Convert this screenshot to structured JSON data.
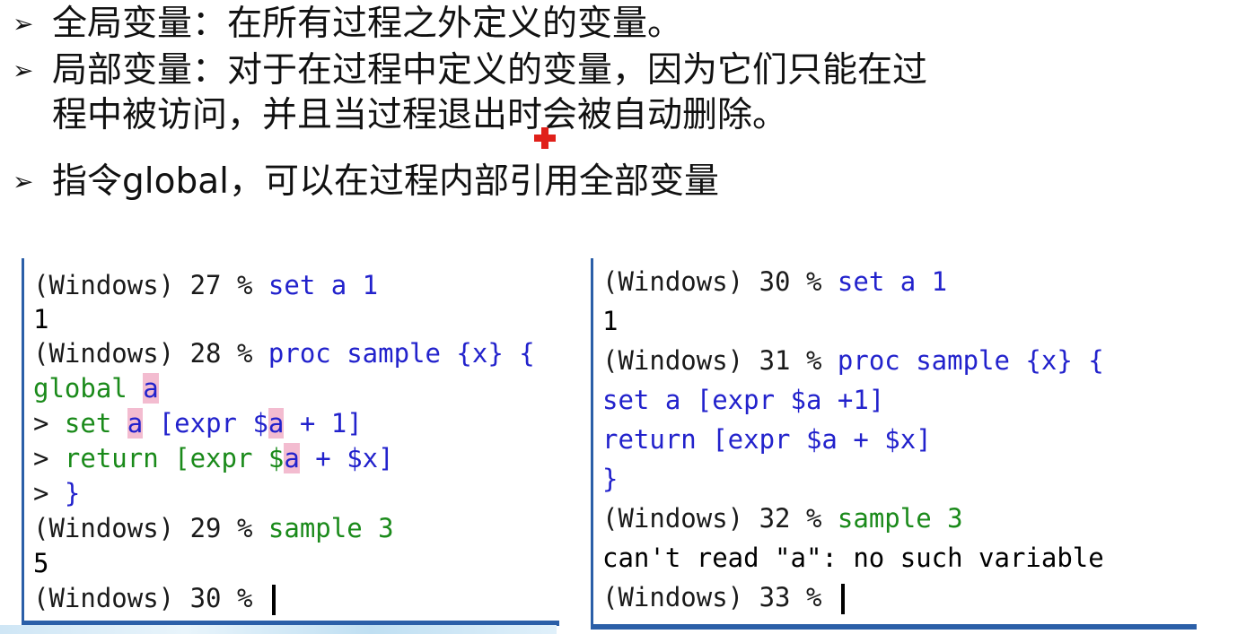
{
  "slide": {
    "bullets": [
      {
        "text": "全局变量：在所有过程之外定义的变量。"
      },
      {
        "text_line1": "局部变量：对于在过程中定义的变量，因为它们只能在过",
        "text_line2": "程中被访问，并且当过程退出时会被自动删除。"
      },
      {
        "text": "指令global，可以在过程内部引用全部变量"
      }
    ],
    "bullet_symbol": "➢"
  },
  "left_console": {
    "lines": [
      {
        "prompt": "(Windows) 27 % ",
        "cmd": "set a 1"
      },
      {
        "out": "1"
      },
      {
        "prompt": "(Windows) 28 % ",
        "cmd": "proc sample {x} {"
      },
      {
        "g1": "global ",
        "g2": "a"
      },
      {
        "p": "> ",
        "s1": "set ",
        "s2": "a",
        "s3": " [expr $",
        "s4": "a",
        "s5": " + 1]"
      },
      {
        "p": "> ",
        "r1": "return [expr $",
        "r2": "a",
        "r3": " + $x]"
      },
      {
        "p": "> ",
        "c": "}"
      },
      {
        "prompt": "(Windows) 29 % ",
        "cmd": "sample 3"
      },
      {
        "out": "5"
      },
      {
        "prompt": "(Windows) 30 % "
      }
    ]
  },
  "right_console": {
    "lines": [
      {
        "prompt": "(Windows) 30 % ",
        "cmd": "set a 1"
      },
      {
        "out": "1"
      },
      {
        "prompt": "(Windows) 31 % ",
        "cmd": "proc sample {x} {"
      },
      {
        "cmd": "set a [expr $a +1]"
      },
      {
        "cmd": "return [expr $a + $x]"
      },
      {
        "cmd": "}"
      },
      {
        "prompt": "(Windows) 32 % ",
        "cmd": "sample 3"
      },
      {
        "out": "can't read \"a\": no such variable"
      },
      {
        "prompt": "(Windows) 33 % "
      }
    ]
  }
}
